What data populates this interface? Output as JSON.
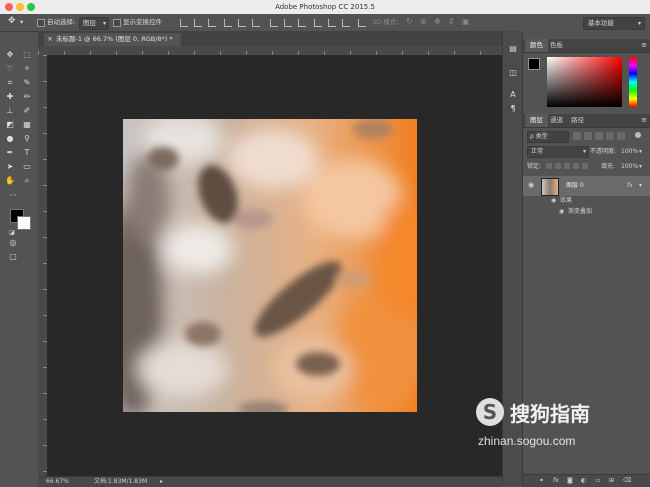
{
  "window": {
    "title": "Adobe Photoshop CC 2015.5",
    "workspace": "基本功能"
  },
  "options_bar": {
    "auto_select_label": "自动选择:",
    "auto_select_value": "图层",
    "show_transform_label": "显示变换控件",
    "mode_3d_label": "3D 模式:"
  },
  "document": {
    "tab_label": "未标题-1 @ 66.7% (图层 0, RGB/8*) *",
    "close_glyph": "×"
  },
  "status": {
    "zoom": "66.67%",
    "doc_info": "文档:1.83M/1.83M"
  },
  "color_panel": {
    "tabs": [
      "颜色",
      "色板"
    ],
    "foreground": "#000000",
    "background": "#ffffff"
  },
  "layers_panel": {
    "tabs": [
      "图层",
      "通道",
      "路径"
    ],
    "filter_label": "ρ 类型",
    "blend_mode": "正常",
    "opacity_label": "不透明度:",
    "opacity_value": "100%",
    "lock_label": "锁定:",
    "fill_label": "填充:",
    "fill_value": "100%",
    "layers": [
      {
        "name": "图层 0",
        "fx": "fx"
      }
    ],
    "effects_label": "效果",
    "effect_item": "渐变叠加"
  },
  "watermark": {
    "brand": "搜狗指南",
    "url": "zhinan.sogou.com"
  },
  "colors": {
    "ui_dark": "#535353",
    "canvas_bg": "#282828",
    "accent_orange": "#f08a30"
  }
}
